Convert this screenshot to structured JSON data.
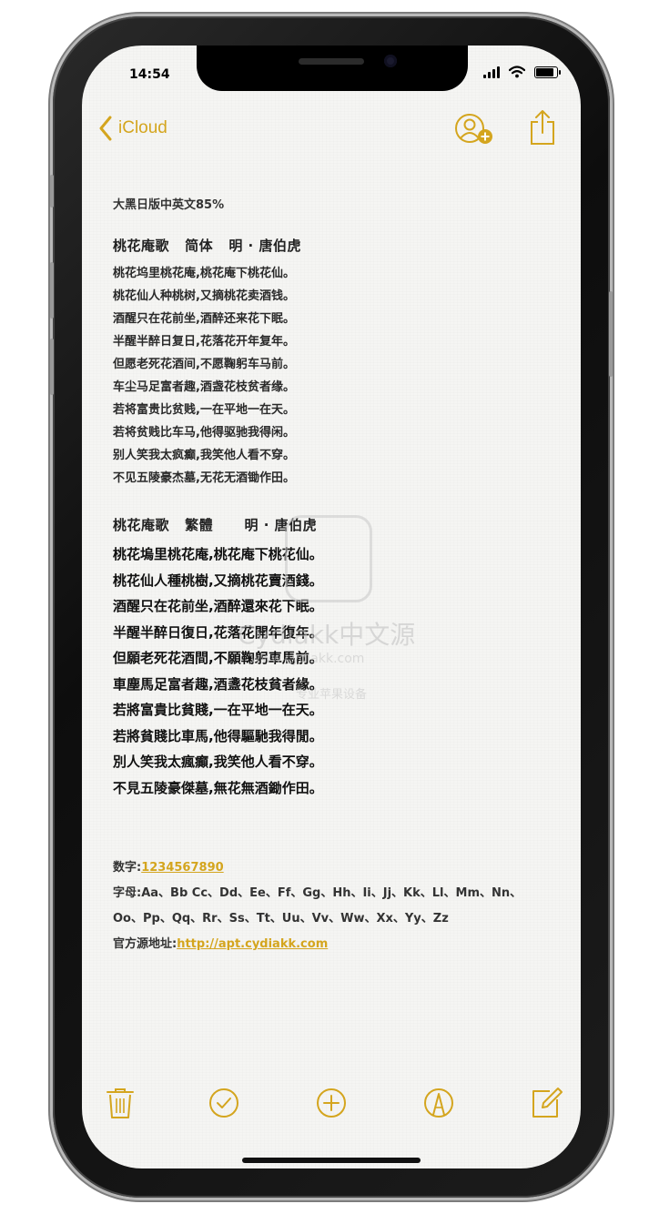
{
  "status_bar": {
    "time": "14:54"
  },
  "nav": {
    "back_label": "iCloud"
  },
  "note": {
    "meta": "大黑日版中英文85%",
    "simplified": {
      "title": "桃花庵歌   简体   明 · 唐伯虎",
      "lines": [
        "桃花坞里桃花庵,桃花庵下桃花仙。",
        "桃花仙人种桃树,又摘桃花卖酒钱。",
        "酒醒只在花前坐,酒醉还来花下眠。",
        "半醒半醉日复日,花落花开年复年。",
        "但愿老死花酒间,不愿鞠躬车马前。",
        "车尘马足富者趣,酒盏花枝贫者缘。",
        "若将富贵比贫贱,一在平地一在天。",
        "若将贫贱比车马,他得驱驰我得闲。",
        "别人笑我太疯癫,我笑他人看不穿。",
        "不见五陵豪杰墓,无花无酒锄作田。"
      ]
    },
    "traditional": {
      "title": "桃花庵歌   繁體      明 · 唐伯虎",
      "lines": [
        "桃花塢里桃花庵,桃花庵下桃花仙。",
        "桃花仙人種桃樹,又摘桃花賣酒錢。",
        "酒醒只在花前坐,酒醉還來花下眠。",
        "半醒半醉日復日,花落花開年復年。",
        "但願老死花酒間,不願鞠躬車馬前。",
        "車塵馬足富者趣,酒盞花枝貧者緣。",
        "若將富貴比貧賤,一在平地一在天。",
        "若將貧賤比車馬,他得驅馳我得閒。",
        "別人笑我太瘋癲,我笑他人看不穿。",
        "不見五陵豪傑墓,無花無酒鋤作田。"
      ]
    },
    "numbers_label": "数字:",
    "numbers_value": "1234567890",
    "letters_label": "字母:",
    "letters_line1": "Aa、Bb Cc、Dd、Ee、Ff、Gg、Hh、Ii、Jj、Kk、Ll、Mm、Nn、",
    "letters_line2": "Oo、Pp、Qq、Rr、Ss、Tt、Uu、Vv、Ww、Xx、Yy、Zz",
    "source_label": "官方源地址:",
    "source_link": "http://apt.cydiakk.com"
  },
  "watermark": {
    "name": "Cydiakk中文源",
    "url": "www.cydiakk.com",
    "sub": "专业苹果设备"
  },
  "icons": {
    "back": "chevron-left-icon",
    "collab": "add-person-icon",
    "share": "share-icon",
    "trash": "trash-icon",
    "check": "checklist-icon",
    "add": "plus-circle-icon",
    "markup": "markup-pen-icon",
    "compose": "compose-icon"
  },
  "colors": {
    "accent": "#d4a51e",
    "paper": "#f5f5f3"
  }
}
